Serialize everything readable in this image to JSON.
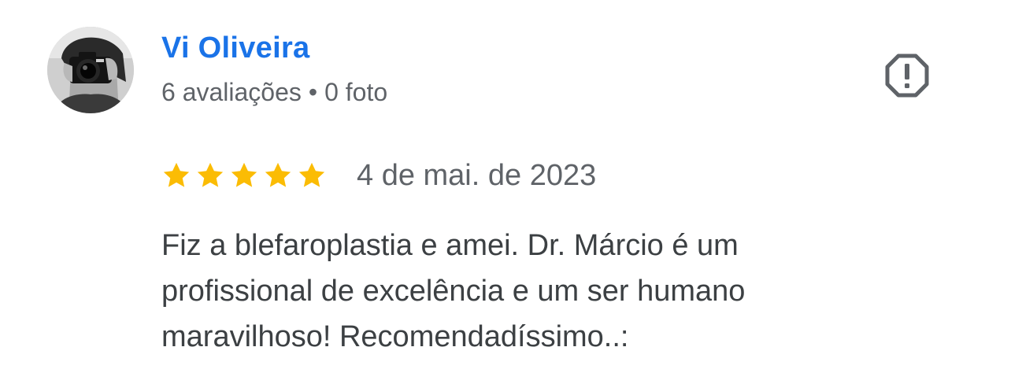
{
  "review": {
    "author": {
      "name": "Vi Oliveira",
      "reviews_count": "6 avaliações",
      "separator": "•",
      "photos_count": "0 foto",
      "avatar_icon": "profile-photo-camera"
    },
    "flag_icon": "report-octagon-icon",
    "rating": {
      "stars": 5,
      "max_stars": 5,
      "star_color": "#fbbc04"
    },
    "date": "4 de mai. de 2023",
    "text": "Fiz a blefaroplastia e amei. Dr. Márcio é um\nprofissional de excelência e um ser humano\nmaravilhoso! Recomendadíssimo..:"
  },
  "colors": {
    "name": "#1a73e8",
    "meta": "#5f6368",
    "body": "#3c4043",
    "icon": "#5f6368"
  }
}
